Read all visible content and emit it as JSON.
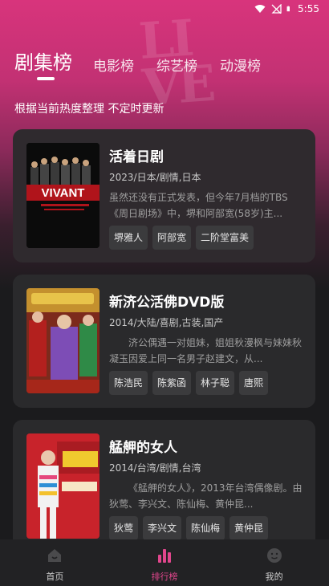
{
  "status_bar": {
    "time": "5:55"
  },
  "tabs": [
    {
      "label": "剧集榜"
    },
    {
      "label": "电影榜"
    },
    {
      "label": "综艺榜"
    },
    {
      "label": "动漫榜"
    }
  ],
  "subtitle": "根据当前热度整理 不定时更新",
  "cards": [
    {
      "title": "活着日剧",
      "meta": "2023/日本/剧情,日本",
      "desc": "虽然还没有正式发表，但今年7月档的TBS《周日剧场》中，堺和阿部宽(58岁)主...",
      "poster_text": "VIVANT",
      "tags": [
        "堺雅人",
        "阿部宽",
        "二阶堂富美"
      ]
    },
    {
      "title": "新济公活佛DVD版",
      "meta": "2014/大陆/喜剧,古装,国产",
      "desc": "济公偶遇一对姐妹，姐姐秋漫枫与妹妹秋凝玉因爱上同一名男子赵建文，从...",
      "tags": [
        "陈浩民",
        "陈紫函",
        "林子聪",
        "唐熙"
      ]
    },
    {
      "title": "艋舺的女人",
      "meta": "2014/台湾/剧情,台湾",
      "desc": "《艋舺的女人》，2013年台湾偶像剧。由狄莺、李兴文、陈仙梅、黄仲昆...",
      "tags": [
        "狄莺",
        "李兴文",
        "陈仙梅",
        "黄仲昆"
      ]
    }
  ],
  "bottom_nav": [
    {
      "label": "首页",
      "icon": "home-icon"
    },
    {
      "label": "排行榜",
      "icon": "ranking-icon"
    },
    {
      "label": "我的",
      "icon": "profile-icon"
    }
  ],
  "colors": {
    "accent": "#e0468c",
    "card_bg": "#2a2a2c",
    "tag_bg": "#3b3b3d"
  }
}
